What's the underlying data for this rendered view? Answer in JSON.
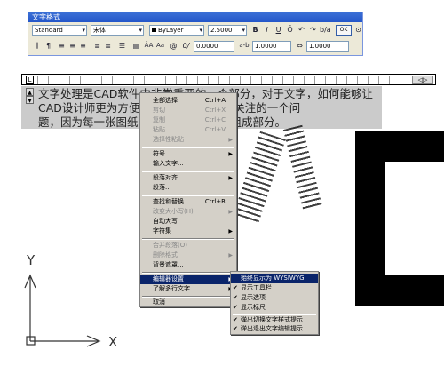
{
  "toolbar": {
    "title": "文字格式",
    "style": "Standard",
    "font": "宋体",
    "color": "ByLayer",
    "height": "2.5000",
    "bold": "B",
    "italic": "I",
    "underline": "U",
    "ok_label": "OK",
    "oblique": "0.0000",
    "ab": "a-b",
    "tracking": "1.0000",
    "width_factor": "1.0000"
  },
  "ruler": {
    "indent_marker": "L",
    "arrows": "◁▷"
  },
  "editor": {
    "line1": "文字处理是CAD软件中非常重要的一个部分，对于文字，如何能够让",
    "line2": "CAD设计师更为方便的                    CAD设计师密切关注的一个问",
    "line3": "题，因为每一张图纸                      不可少的一个重要组成部分。"
  },
  "context_menu": {
    "items": [
      {
        "label": "全部选择",
        "shortcut": "Ctrl+A"
      },
      {
        "label": "剪切",
        "shortcut": "Ctrl+X"
      },
      {
        "label": "复制",
        "shortcut": "Ctrl+C"
      },
      {
        "label": "粘贴",
        "shortcut": "Ctrl+V"
      },
      {
        "label": "选择性粘贴"
      },
      {
        "label": "符号"
      },
      {
        "label": "输入文字..."
      },
      {
        "label": "段落对齐"
      },
      {
        "label": "段落..."
      },
      {
        "label": "查找和替换...",
        "shortcut": "Ctrl+R"
      },
      {
        "label": "改变大小写(H)"
      },
      {
        "label": "自动大写"
      },
      {
        "label": "字符集"
      },
      {
        "label": "合并段落(O)"
      },
      {
        "label": "删除格式"
      },
      {
        "label": "背景遮罩..."
      },
      {
        "label": "编辑器设置"
      },
      {
        "label": "了解多行文字"
      },
      {
        "label": "取消"
      }
    ]
  },
  "submenu": {
    "items": [
      {
        "label": "始终显示为 WYSIWYG"
      },
      {
        "label": "显示工具栏"
      },
      {
        "label": "显示选项"
      },
      {
        "label": "显示标尺"
      },
      {
        "label": "弹出切换文字样式提示"
      },
      {
        "label": "弹出退出文字编辑提示"
      }
    ]
  },
  "ucs": {
    "y_label": "Y",
    "x_label": "X"
  },
  "colors": {
    "menu_bg": "#d4d0c8",
    "highlight": "#0a246a",
    "titlebar": "#2456c9",
    "editor_bg": "#cbcbcb"
  }
}
